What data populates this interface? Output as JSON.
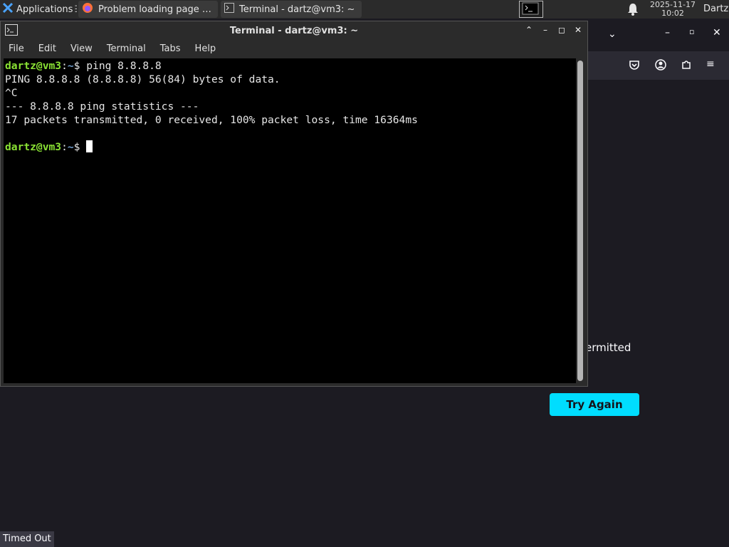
{
  "panel": {
    "applications_label": "Applications",
    "tasks": [
      {
        "label": "Problem loading page …",
        "icon": "firefox-icon"
      },
      {
        "label": "Terminal - dartz@vm3: ~",
        "icon": "terminal-icon"
      }
    ],
    "clock_date": "2025-11-17",
    "clock_time": "10:02",
    "user": "Dartz"
  },
  "terminal": {
    "title": "Terminal - dartz@vm3: ~",
    "menu": [
      "File",
      "Edit",
      "View",
      "Terminal",
      "Tabs",
      "Help"
    ],
    "prompt_user": "dartz@vm3",
    "prompt_sep": ":",
    "prompt_path": "~",
    "prompt_symbol": "$ ",
    "command": "ping 8.8.8.8",
    "output": [
      "PING 8.8.8.8 (8.8.8.8) 56(84) bytes of data.",
      "^C",
      "--- 8.8.8.8 ping statistics ---",
      "17 packets transmitted, 0 received, 100% packet loss, time 16364ms",
      ""
    ]
  },
  "firefox": {
    "partial_message": "ermitted",
    "try_again_label": "Try Again",
    "status_text": "Timed Out"
  },
  "colors": {
    "prompt_user": "#8ae234",
    "prompt_path": "#729fcf",
    "try_again_bg": "#00ddff"
  }
}
